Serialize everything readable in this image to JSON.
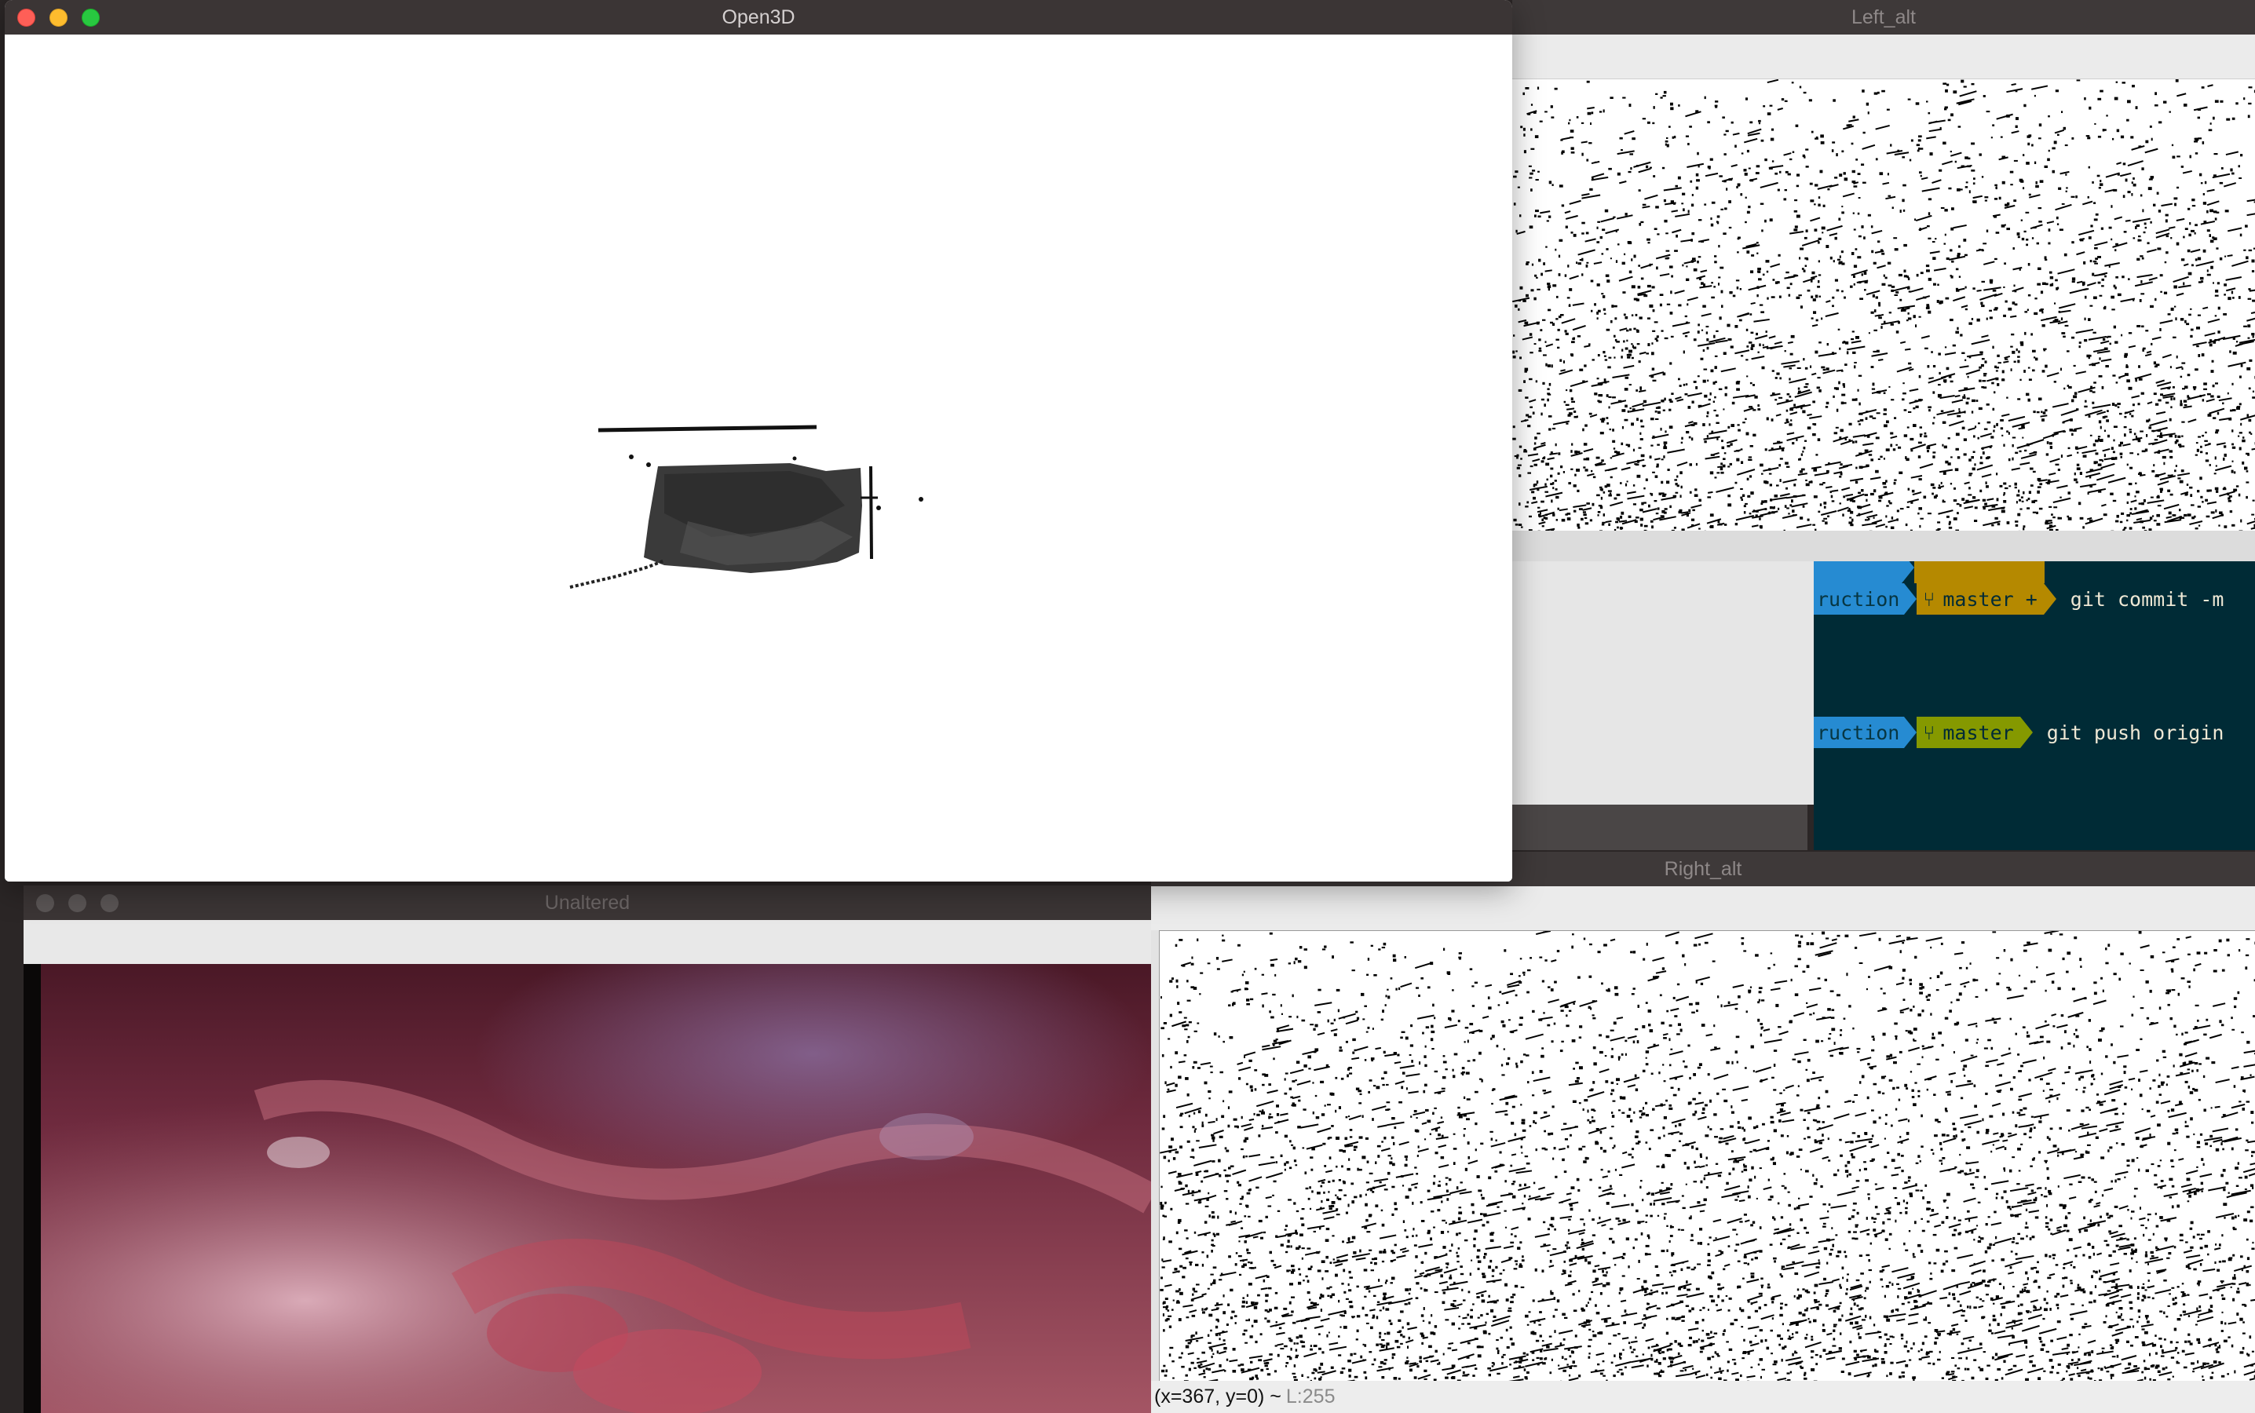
{
  "windows": {
    "open3d": {
      "title": "Open3D"
    },
    "left_alt": {
      "title": "Left_alt"
    },
    "right_alt": {
      "title": "Right_alt",
      "status": {
        "coords": "(x=367, y=0) ~",
        "luma": "L:255"
      }
    },
    "unaltered": {
      "title": "Unaltered"
    }
  },
  "terminal": {
    "lines": [
      {
        "dir": "ruction",
        "branch": "master +",
        "branch_color": "#b58900",
        "command": "git commit -m"
      },
      {
        "dir": "ruction",
        "branch": "master",
        "branch_color": "#859900",
        "command": "git push origin"
      }
    ]
  },
  "colors": {
    "close": "#fe5f57",
    "minimize": "#febc2e",
    "zoom": "#28c840",
    "term_bg": "#002b36",
    "seg_dir": "#268bd2"
  }
}
